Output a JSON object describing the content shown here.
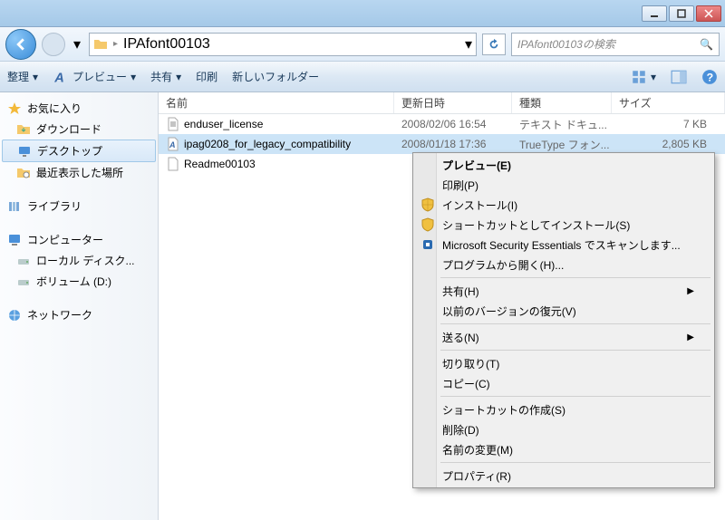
{
  "breadcrumb": {
    "folder": "IPAfont00103"
  },
  "search": {
    "placeholder": "IPAfont00103の検索"
  },
  "toolbar": {
    "organize": "整理",
    "preview": "プレビュー",
    "share": "共有",
    "print": "印刷",
    "new_folder": "新しいフォルダー"
  },
  "sidebar": {
    "favorites": {
      "label": "お気に入り",
      "items": [
        {
          "label": "ダウンロード"
        },
        {
          "label": "デスクトップ"
        },
        {
          "label": "最近表示した場所"
        }
      ]
    },
    "libraries": {
      "label": "ライブラリ"
    },
    "computer": {
      "label": "コンピューター",
      "items": [
        {
          "label": "ローカル ディスク..."
        },
        {
          "label": "ボリューム (D:)"
        }
      ]
    },
    "network": {
      "label": "ネットワーク"
    }
  },
  "columns": {
    "name": "名前",
    "date": "更新日時",
    "type": "種類",
    "size": "サイズ"
  },
  "files": [
    {
      "name": "enduser_license",
      "date": "2008/02/06 16:54",
      "type": "テキスト ドキュ...",
      "size": "7 KB"
    },
    {
      "name": "ipag0208_for_legacy_compatibility",
      "date": "2008/01/18 17:36",
      "type": "TrueType フォン...",
      "size": "2,805 KB"
    },
    {
      "name": "Readme00103",
      "date": "",
      "type": "",
      "size": ""
    }
  ],
  "ctx": {
    "preview": "プレビュー(E)",
    "print": "印刷(P)",
    "install": "インストール(I)",
    "install_shortcut": "ショートカットとしてインストール(S)",
    "mse": "Microsoft Security Essentials でスキャンします...",
    "open_with": "プログラムから開く(H)...",
    "share": "共有(H)",
    "prev_versions": "以前のバージョンの復元(V)",
    "send_to": "送る(N)",
    "cut": "切り取り(T)",
    "copy": "コピー(C)",
    "create_shortcut": "ショートカットの作成(S)",
    "delete": "削除(D)",
    "rename": "名前の変更(M)",
    "properties": "プロパティ(R)"
  }
}
